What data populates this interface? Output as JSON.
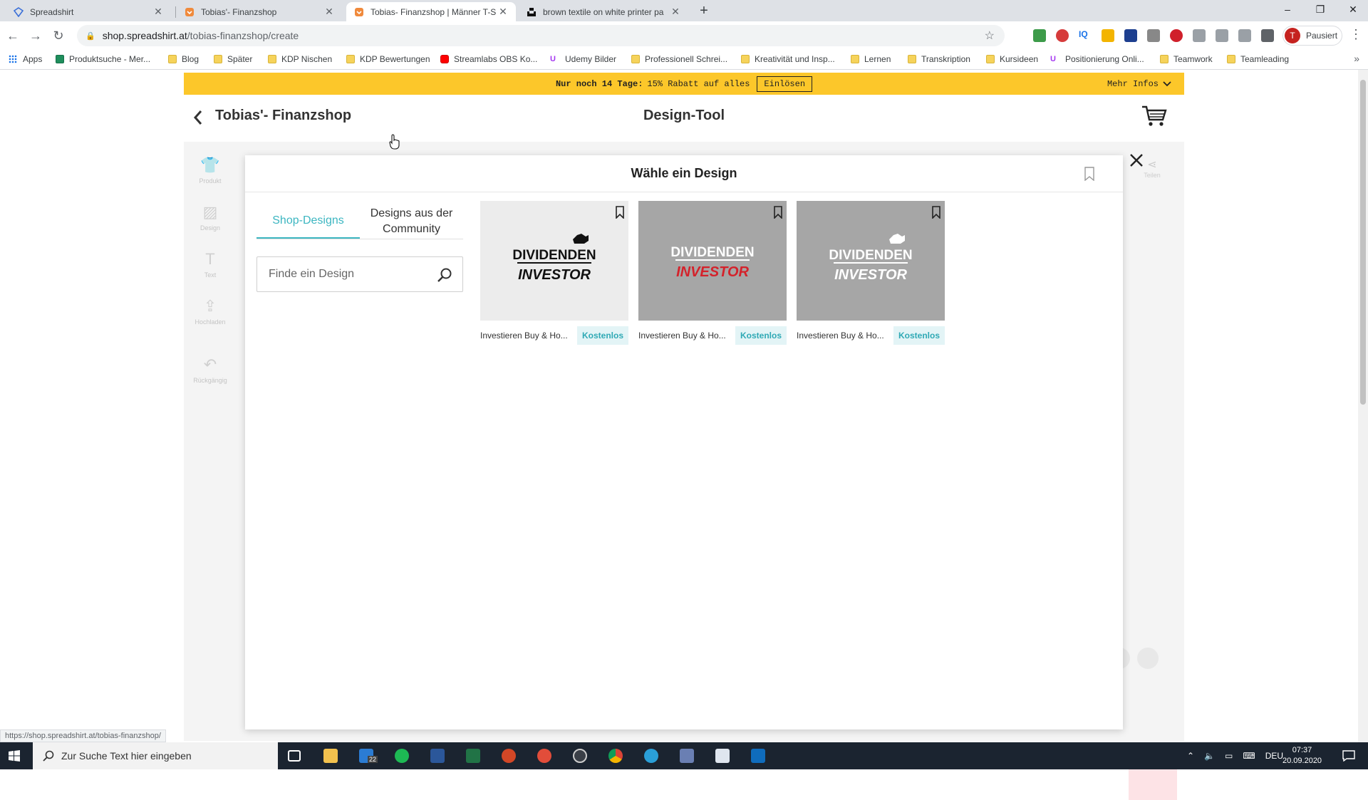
{
  "browser": {
    "tabs": [
      {
        "title": "Spreadshirt",
        "active": false
      },
      {
        "title": "Tobias'- Finanzshop",
        "active": false
      },
      {
        "title": "Tobias- Finanzshop | Männer T-S",
        "active": true
      },
      {
        "title": "brown textile on white printer pa",
        "active": false
      }
    ],
    "url_host": "shop.spreadshirt.at",
    "url_path": "/tobias-finanzshop/create",
    "profile_label": "Pausiert",
    "profile_initial": "T",
    "bookmarks": [
      "Apps",
      "Produktsuche - Mer...",
      "Blog",
      "Später",
      "KDP Nischen",
      "KDP Bewertungen",
      "Streamlabs OBS Ko...",
      "Udemy Bilder",
      "Professionell Schrei...",
      "Kreativität und Insp...",
      "Lernen",
      "Transkription",
      "Kursideen",
      "Positionierung Onli...",
      "Teamwork",
      "Teamleading"
    ],
    "status_url": "https://shop.spreadshirt.at/tobias-finanzshop/"
  },
  "promo": {
    "text_bold": "Nur noch 14 Tage:",
    "text": "15% Rabatt auf alles",
    "redeem_label": "Einlösen",
    "more_label": "Mehr Infos"
  },
  "header": {
    "shop_title": "Tobias'- Finanzshop",
    "tool_title": "Design-Tool"
  },
  "sidebar": {
    "items": [
      "Produkt",
      "Design",
      "Text",
      "Hochladen",
      "Rückgängig"
    ],
    "right_item": "Teilen"
  },
  "modal": {
    "title": "Wähle ein Design",
    "tabs": [
      "Shop-Designs",
      "Designs aus der Community"
    ],
    "search_placeholder": "Finde ein Design",
    "designs": [
      {
        "name": "Investieren Buy & Ho...",
        "badge": "Kostenlos",
        "line1": "DIVIDENDEN",
        "line2": "INVESTOR",
        "bg": "#ececec",
        "line1_color": "#111111",
        "line2_color": "#111111"
      },
      {
        "name": "Investieren Buy & Ho...",
        "badge": "Kostenlos",
        "line1": "DIVIDENDEN",
        "line2": "INVESTOR",
        "bg": "#a6a6a6",
        "line1_color": "#ffffff",
        "line2_color": "#d4222b"
      },
      {
        "name": "Investieren Buy & Ho...",
        "badge": "Kostenlos",
        "line1": "DIVIDENDEN",
        "line2": "INVESTOR",
        "bg": "#a6a6a6",
        "line1_color": "#ffffff",
        "line2_color": "#ffffff"
      }
    ]
  },
  "taskbar": {
    "search_placeholder": "Zur Suche Text hier eingeben",
    "language": "DEU",
    "time": "07:37",
    "date": "20.09.2020",
    "mail_badge": "22"
  },
  "colors": {
    "accent": "#3cb6c1",
    "promo": "#fcc72a",
    "badge_bg": "#e3f4f6"
  }
}
